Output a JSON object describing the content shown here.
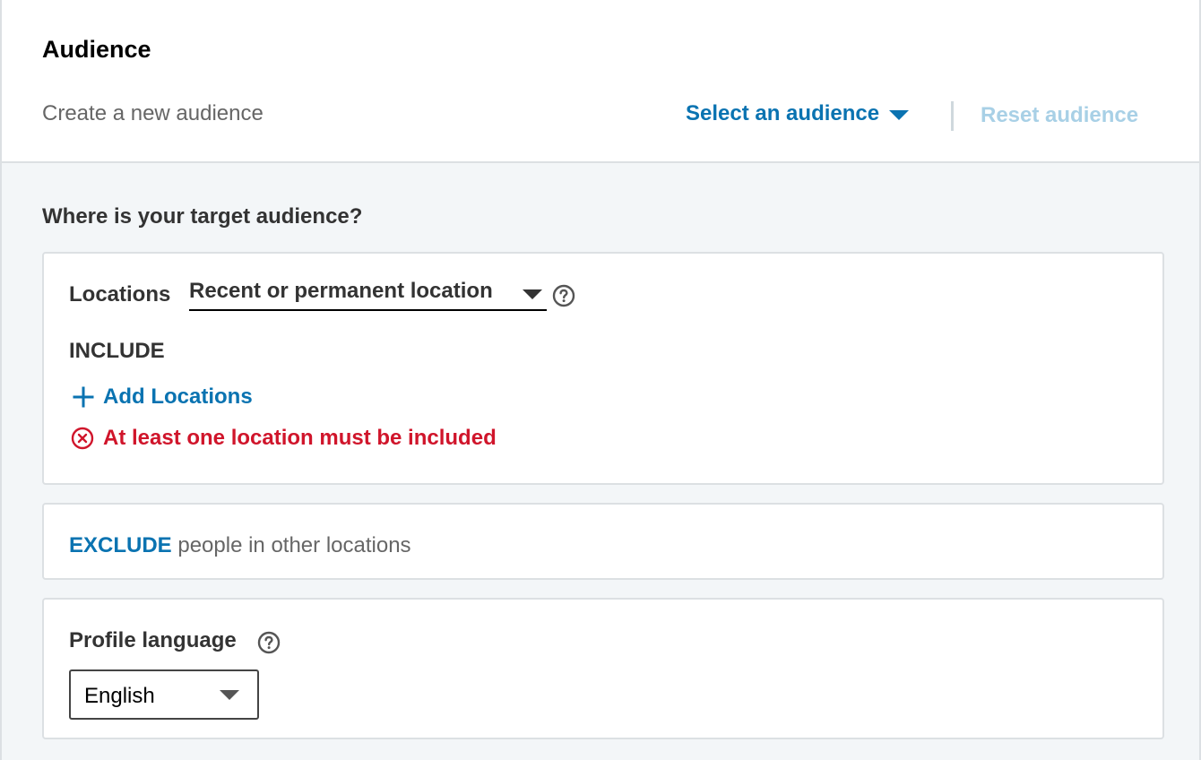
{
  "header": {
    "title": "Audience",
    "subtitle": "Create a new audience",
    "select_audience_label": "Select an audience",
    "reset_label": "Reset audience"
  },
  "locations": {
    "question": "Where is your target audience?",
    "label": "Locations",
    "location_type_selected": "Recent or permanent location",
    "include_heading": "INCLUDE",
    "add_label": "Add Locations",
    "error_text": "At least one location must be included"
  },
  "exclude": {
    "link_label": "EXCLUDE",
    "rest_text": "people in other locations"
  },
  "profile_language": {
    "label": "Profile language",
    "selected": "English"
  },
  "icons": {
    "select_caret": "chevron-down-icon",
    "help": "help-circle-icon",
    "add": "plus-icon",
    "error": "error-circle-x-icon"
  },
  "colors": {
    "link": "#0a73b1",
    "link_disabled": "#a8d0e6",
    "error": "#d0152b",
    "text_primary": "#333333",
    "text_secondary": "#666666",
    "border": "#dce0e3",
    "background": "#f3f6f8"
  }
}
